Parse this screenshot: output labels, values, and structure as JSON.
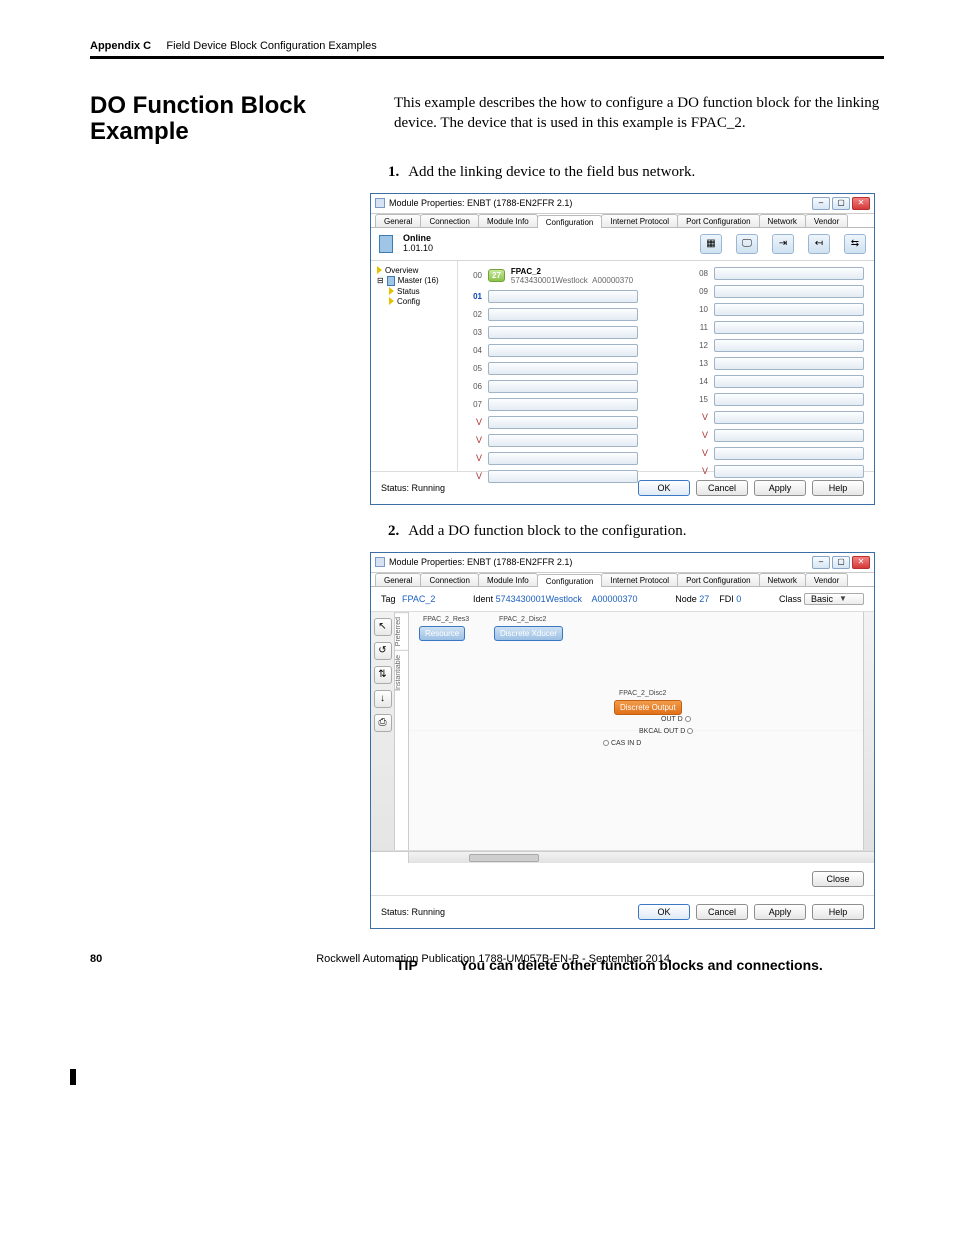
{
  "header": {
    "appendix": "Appendix C",
    "title": "Field Device Block Configuration Examples"
  },
  "section": {
    "heading": "DO Function Block Example",
    "intro": "This example describes the how to configure a DO function block for the linking device. The device that is used in this example is FPAC_2."
  },
  "steps": {
    "s1": {
      "num": "1.",
      "text": "Add the linking device to the field bus network."
    },
    "s2": {
      "num": "2.",
      "text": "Add a DO function block to the configuration."
    }
  },
  "window1": {
    "title": "Module Properties: ENBT (1788-EN2FFR 2.1)",
    "tabs": {
      "general": "General",
      "connection": "Connection",
      "moduleInfo": "Module Info",
      "configuration": "Configuration",
      "internetProtocol": "Internet Protocol",
      "portConfig": "Port Configuration",
      "network": "Network",
      "vendor": "Vendor"
    },
    "online": {
      "label": "Online",
      "version": "1.01.10"
    },
    "tree": {
      "overview": "Overview",
      "master": "Master (16)",
      "status": "Status",
      "config": "Config"
    },
    "slot00": {
      "num": "00",
      "chip": "27",
      "line1": "FPAC_2",
      "line2": "5743430001Westlock",
      "code": "A00000370"
    },
    "slots_left": [
      "01",
      "02",
      "03",
      "04",
      "05",
      "06",
      "07",
      "V",
      "V",
      "V",
      "V"
    ],
    "slots_right": [
      "08",
      "09",
      "10",
      "11",
      "12",
      "13",
      "14",
      "15",
      "V",
      "V",
      "V",
      "V"
    ],
    "status": "Status: Running",
    "buttons": {
      "ok": "OK",
      "cancel": "Cancel",
      "apply": "Apply",
      "help": "Help"
    }
  },
  "window2": {
    "title": "Module Properties: ENBT (1788-EN2FFR 2.1)",
    "top": {
      "tagLabel": "Tag",
      "tag": "FPAC_2",
      "identLabel": "Ident",
      "ident": "5743430001Westlock",
      "identCode": "A00000370",
      "nodeLabel": "Node",
      "node": "27",
      "fdiLabel": "FDI",
      "fdi": "0",
      "classLabel": "Class",
      "class": "Basic"
    },
    "vtabs": {
      "pref": "Preferred",
      "inst": "Instantiable"
    },
    "blocks": {
      "res": {
        "cap": "FPAC_2_Res3",
        "label": "Resource"
      },
      "disc": {
        "cap": "FPAC_2_Disc2",
        "label": "Discrete Xducer"
      },
      "do": {
        "cap": "FPAC_2_Disc2",
        "label": "Discrete Output",
        "ports": {
          "outd": "OUT D",
          "bkcal": "BKCAL OUT D",
          "casin": "CAS IN D"
        }
      }
    },
    "closeBtn": "Close",
    "status": "Status: Running",
    "buttons": {
      "ok": "OK",
      "cancel": "Cancel",
      "apply": "Apply",
      "help": "Help"
    }
  },
  "tip": {
    "label": "TIP",
    "text": "You can delete other function blocks and connections."
  },
  "footer": {
    "pageNum": "80",
    "pub": "Rockwell Automation Publication 1788-UM057B-EN-P - September 2014"
  }
}
